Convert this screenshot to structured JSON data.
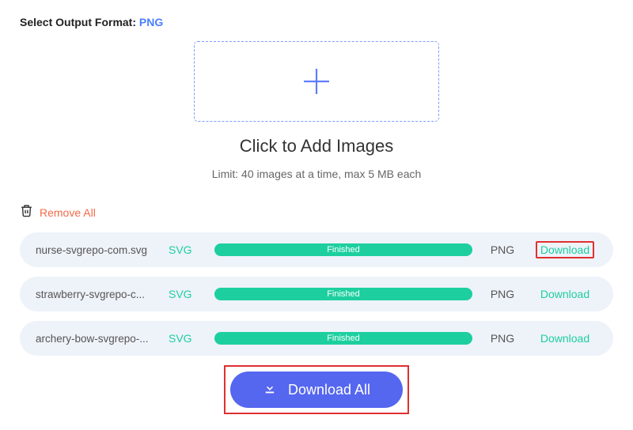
{
  "format": {
    "label": "Select Output Format: ",
    "value": "PNG"
  },
  "dropzone": {
    "add_text": "Click to Add Images",
    "limit_text": "Limit: 40 images at a time, max 5 MB each"
  },
  "remove": {
    "label": "Remove All"
  },
  "files": [
    {
      "name": "nurse-svgrepo-com.svg",
      "src_type": "SVG",
      "status": "Finished",
      "target_type": "PNG",
      "download": "Download",
      "highlight": true
    },
    {
      "name": "strawberry-svgrepo-c...",
      "src_type": "SVG",
      "status": "Finished",
      "target_type": "PNG",
      "download": "Download",
      "highlight": false
    },
    {
      "name": "archery-bow-svgrepo-...",
      "src_type": "SVG",
      "status": "Finished",
      "target_type": "PNG",
      "download": "Download",
      "highlight": false
    }
  ],
  "download_all": {
    "label": "Download All"
  },
  "colors": {
    "accent_blue": "#5566ef",
    "link_blue": "#4a7fff",
    "green": "#1dcf9f",
    "orange": "#f26a4a",
    "highlight_red": "#e03030"
  }
}
